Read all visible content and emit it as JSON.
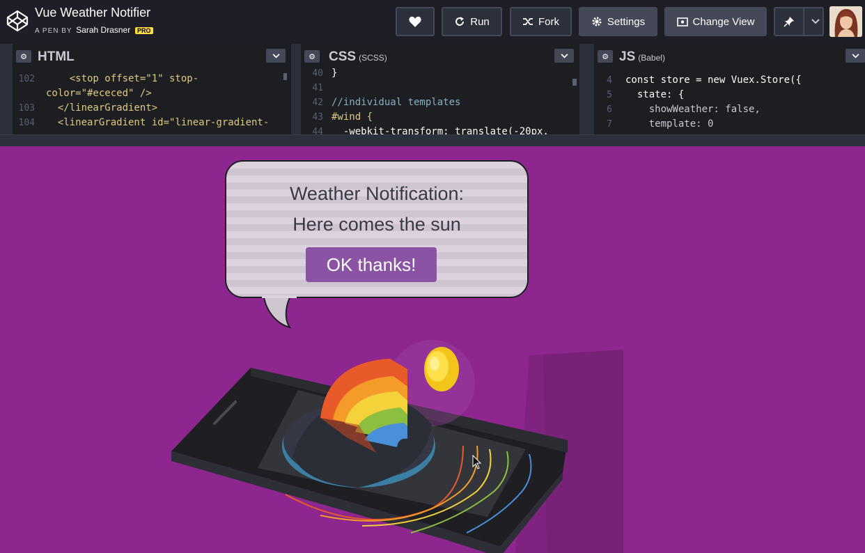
{
  "header": {
    "title": "Vue Weather Notifier",
    "pen_by": "A PEN BY",
    "author": "Sarah Drasner",
    "badge": "PRO",
    "buttons": {
      "run": "Run",
      "fork": "Fork",
      "settings": "Settings",
      "change_view": "Change View"
    }
  },
  "editors": {
    "html": {
      "title": "HTML",
      "subtitle": "",
      "lines": [
        {
          "num": "102",
          "text": "    <stop offset=\"1\" stop-"
        },
        {
          "num": "",
          "text": "color=\"#ececed\" />"
        },
        {
          "num": "103",
          "text": "  </linearGradient>"
        },
        {
          "num": "104",
          "text": "  <linearGradient id=\"linear-gradient-"
        }
      ]
    },
    "css": {
      "title": "CSS",
      "subtitle": "(SCSS)",
      "lines": [
        {
          "num": "40",
          "text": "}"
        },
        {
          "num": "41",
          "text": ""
        },
        {
          "num": "42",
          "text": "//individual templates"
        },
        {
          "num": "43",
          "text": "#wind {"
        },
        {
          "num": "44",
          "text": "  -webkit-transform: translate(-20px,"
        }
      ]
    },
    "js": {
      "title": "JS",
      "subtitle": "(Babel)",
      "lines": [
        {
          "num": "4",
          "text": "const store = new Vuex.Store({"
        },
        {
          "num": "5",
          "text": "  state: {"
        },
        {
          "num": "6",
          "text": "    showWeather: false,"
        },
        {
          "num": "7",
          "text": "    template: 0"
        }
      ]
    }
  },
  "preview": {
    "notification_line1": "Weather Notification:",
    "notification_line2": "Here comes the sun",
    "ok_button": "OK thanks!"
  },
  "colors": {
    "preview_bg": "#8e268f",
    "button_purple": "#8a53a4",
    "pro_badge": "#ffdd40"
  },
  "icons": [
    "codepen-logo-icon",
    "heart-icon",
    "run-icon",
    "fork-icon",
    "gear-icon",
    "change-view-icon",
    "pin-icon",
    "chevron-down-icon"
  ]
}
